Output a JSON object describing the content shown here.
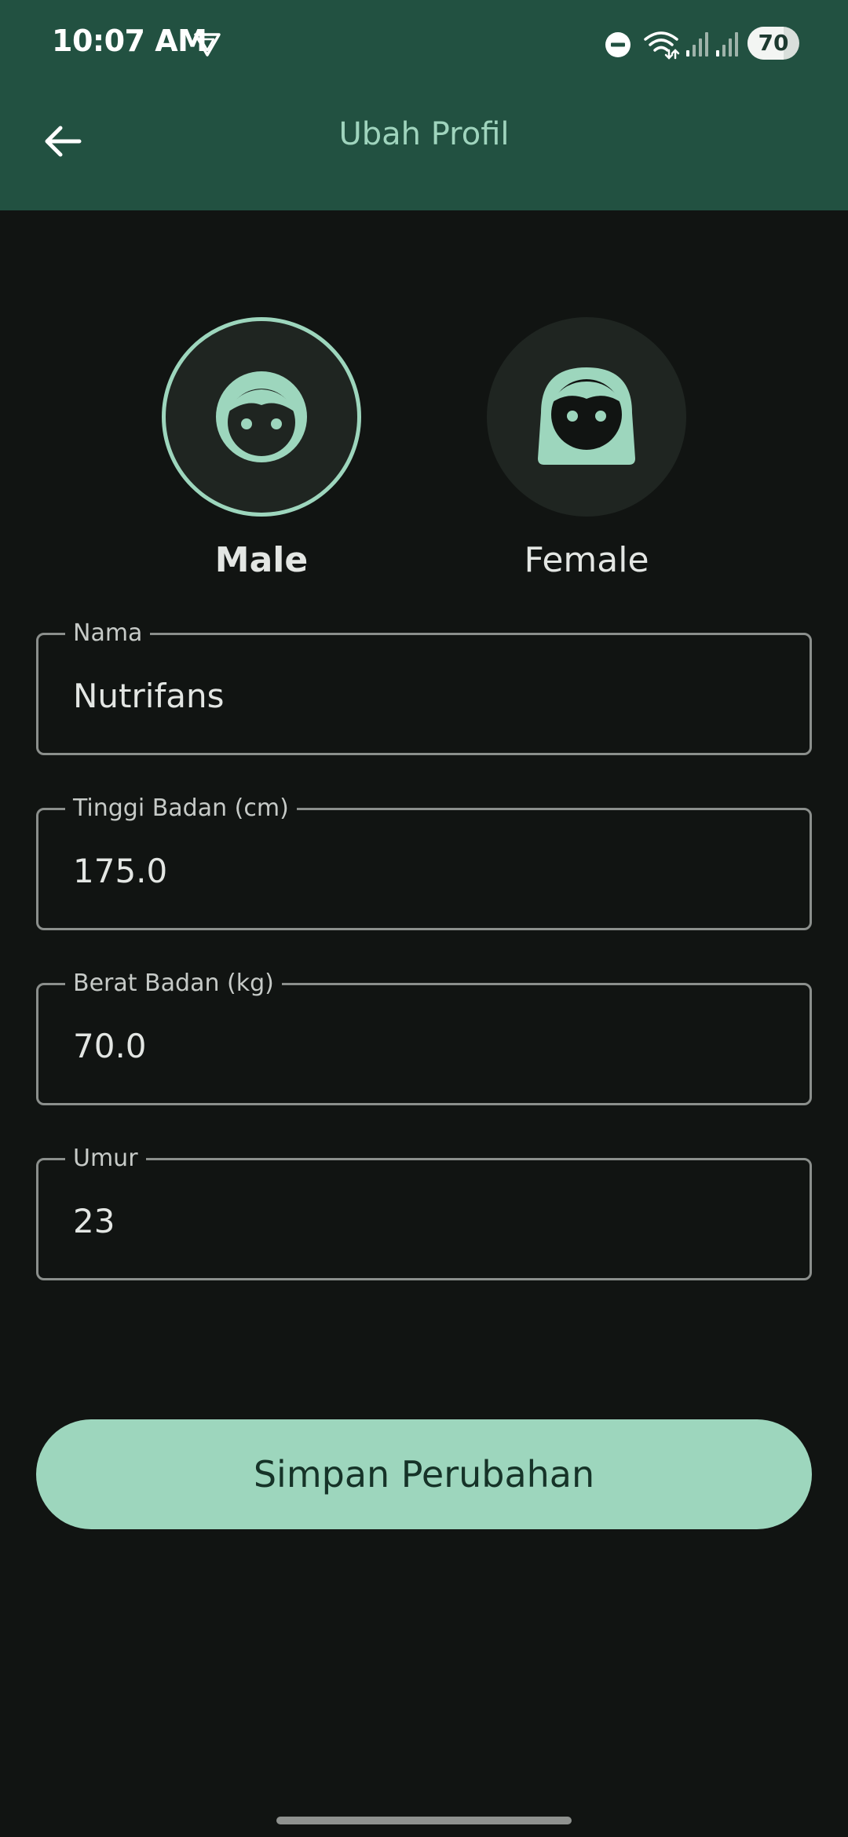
{
  "status_bar": {
    "time": "10:07 AM",
    "battery_level": "70",
    "battery_fraction": 0.7
  },
  "app_bar": {
    "title": "Ubah Profil",
    "back_icon": "arrow-left-icon"
  },
  "gender": {
    "options": [
      {
        "label": "Male",
        "icon": "male-face-icon",
        "selected": true
      },
      {
        "label": "Female",
        "icon": "female-face-icon",
        "selected": false
      }
    ]
  },
  "form": {
    "fields": [
      {
        "label": "Nama",
        "value": "Nutrifans"
      },
      {
        "label": "Tinggi Badan (cm)",
        "value": "175.0"
      },
      {
        "label": "Berat Badan (kg)",
        "value": "70.0"
      },
      {
        "label": "Umur",
        "value": "23"
      }
    ]
  },
  "actions": {
    "save_label": "Simpan Perubahan"
  },
  "colors": {
    "app_bar": "#225141",
    "background": "#111412",
    "accent": "#9dd6bd",
    "title": "#9fd4bd",
    "outline": "#8b8f8c"
  }
}
